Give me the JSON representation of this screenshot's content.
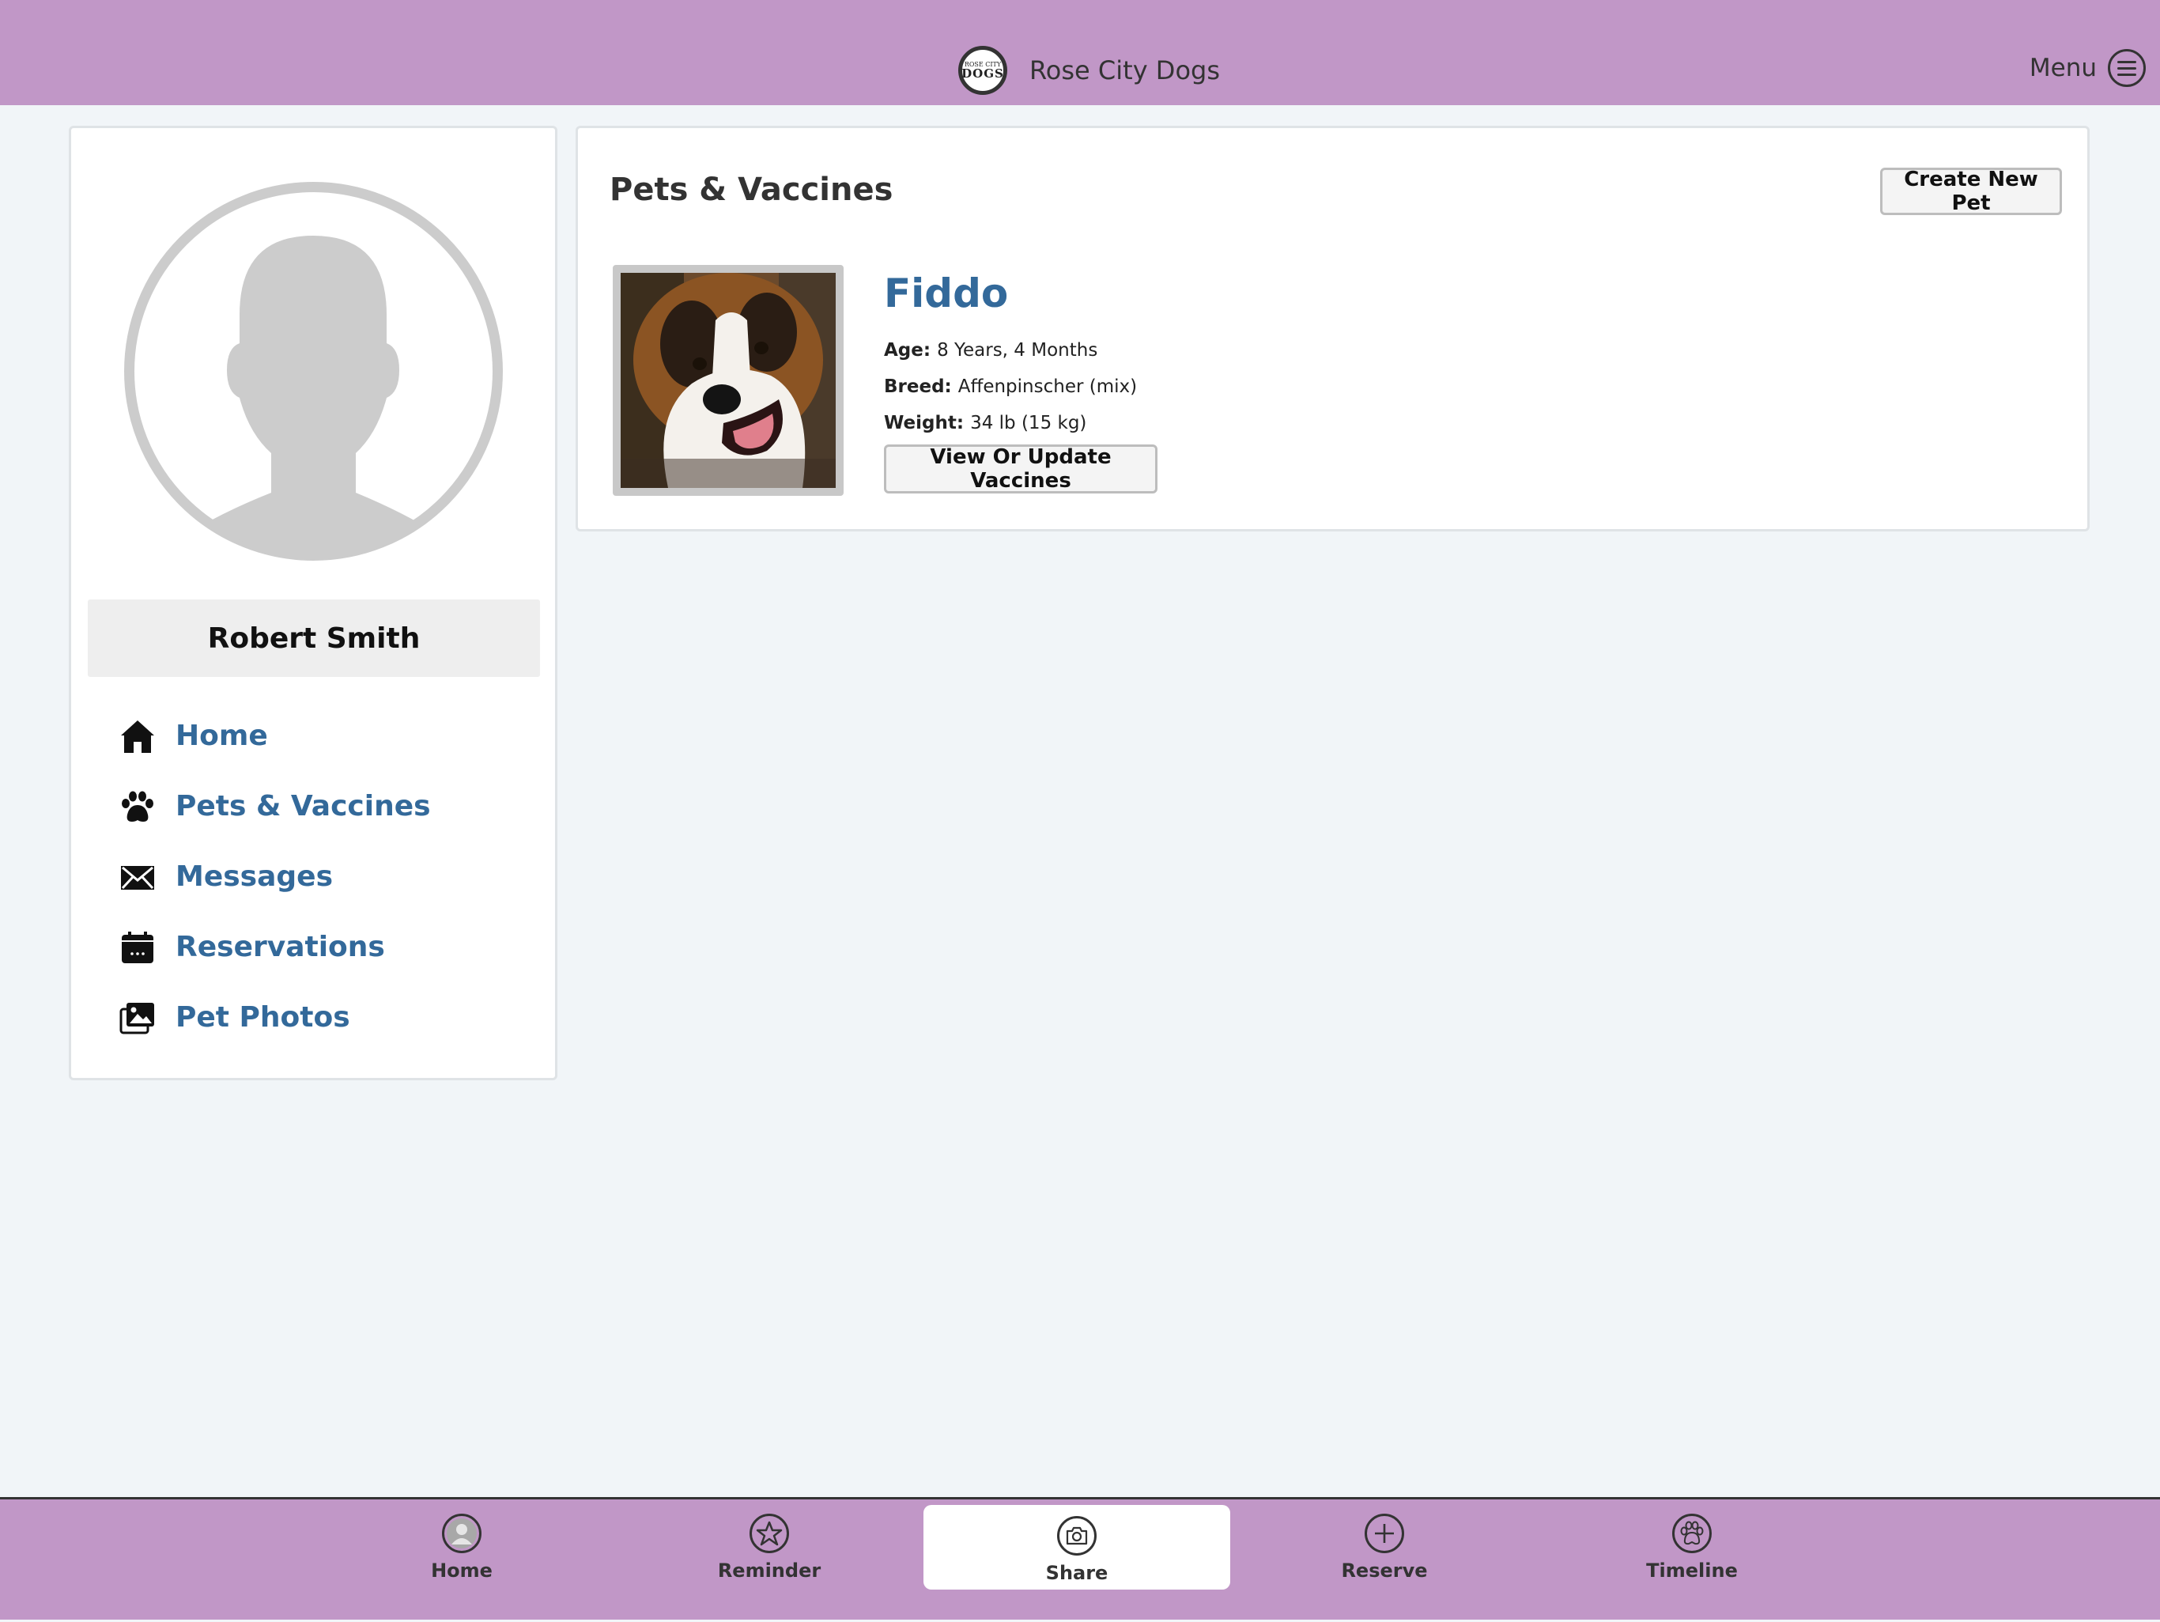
{
  "header": {
    "brand_logo_line1": "ROSE CITY",
    "brand_logo_line2": "DOGS",
    "brand_name": "Rose City Dogs",
    "menu_label": "Menu"
  },
  "sidebar": {
    "user_name": "Robert Smith",
    "items": [
      {
        "label": "Home",
        "icon": "home-icon"
      },
      {
        "label": "Pets & Vaccines",
        "icon": "paw-icon"
      },
      {
        "label": "Messages",
        "icon": "envelope-icon"
      },
      {
        "label": "Reservations",
        "icon": "calendar-icon"
      },
      {
        "label": "Pet Photos",
        "icon": "photos-icon"
      }
    ]
  },
  "main": {
    "title": "Pets & Vaccines",
    "create_button": "Create New Pet",
    "pets": [
      {
        "name": "Fiddo",
        "age_label": "Age:",
        "age": "8 Years, 4 Months",
        "breed_label": "Breed:",
        "breed": "Affenpinscher (mix)",
        "weight_label": "Weight:",
        "weight": "34 lb (15 kg)",
        "vaccines_button": "View Or Update Vaccines"
      }
    ]
  },
  "bottom_nav": {
    "tabs": [
      {
        "label": "Home",
        "icon": "user-icon"
      },
      {
        "label": "Reminder",
        "icon": "star-icon"
      },
      {
        "label": "Share",
        "icon": "camera-icon",
        "active": true
      },
      {
        "label": "Reserve",
        "icon": "plus-icon"
      },
      {
        "label": "Timeline",
        "icon": "paw-icon"
      }
    ]
  },
  "colors": {
    "header_bg": "#c197c7",
    "link_blue": "#33699a",
    "page_bg": "#f1f5f8"
  }
}
